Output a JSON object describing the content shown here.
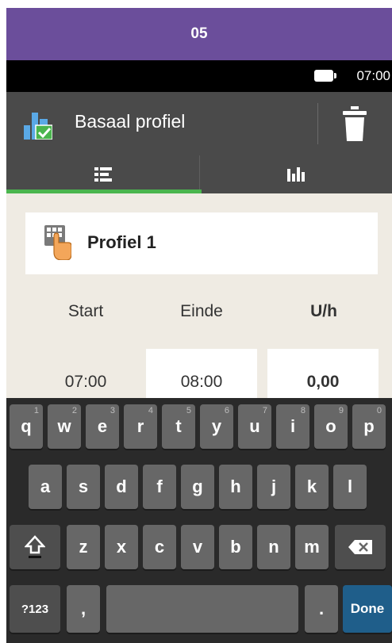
{
  "step_banner": "05",
  "status_bar": {
    "time": "07:00",
    "battery_icon": "battery-icon"
  },
  "title_bar": {
    "title": "Basaal profiel",
    "icon": "basal-profile-check-icon",
    "action_icon": "trash-icon"
  },
  "tabs": [
    {
      "icon": "list-icon",
      "selected": true
    },
    {
      "icon": "bar-chart-icon",
      "selected": false
    }
  ],
  "profile": {
    "name": "Profiel 1",
    "icon": "hand-keypad-icon"
  },
  "table": {
    "headers": {
      "start": "Start",
      "end": "Einde",
      "rate": "U/h"
    },
    "row": {
      "start": "07:00",
      "end": "08:00",
      "rate": "0,00"
    }
  },
  "keyboard": {
    "row1": [
      {
        "key": "q",
        "hint": "1"
      },
      {
        "key": "w",
        "hint": "2"
      },
      {
        "key": "e",
        "hint": "3"
      },
      {
        "key": "r",
        "hint": "4"
      },
      {
        "key": "t",
        "hint": "5"
      },
      {
        "key": "y",
        "hint": "6"
      },
      {
        "key": "u",
        "hint": "7"
      },
      {
        "key": "i",
        "hint": "8"
      },
      {
        "key": "o",
        "hint": "9"
      },
      {
        "key": "p",
        "hint": "0"
      }
    ],
    "row2": [
      "a",
      "s",
      "d",
      "f",
      "g",
      "h",
      "j",
      "k",
      "l"
    ],
    "row3": [
      "z",
      "x",
      "c",
      "v",
      "b",
      "n",
      "m"
    ],
    "shift_icon": "shift-icon",
    "backspace_icon": "backspace-icon",
    "symbols_label": "?123",
    "comma_label": ",",
    "period_label": ".",
    "done_label": "Done"
  },
  "colors": {
    "banner": "#6b4e9b",
    "header": "#4a4a4a",
    "accent_green": "#4ab54e",
    "content_bg": "#efebe3",
    "done_key": "#1f5e8a"
  }
}
